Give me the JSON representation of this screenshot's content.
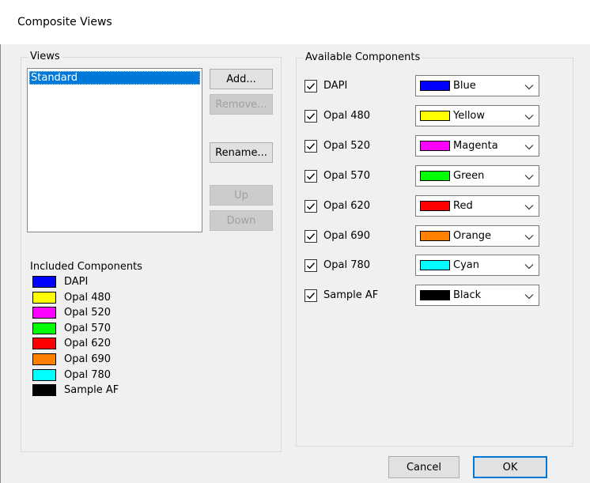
{
  "window": {
    "title": "Composite Views"
  },
  "views": {
    "label": "Views",
    "items": [
      "Standard"
    ],
    "buttons": {
      "add": "Add...",
      "remove": "Remove...",
      "rename": "Rename...",
      "up": "Up",
      "down": "Down"
    }
  },
  "included": {
    "label": "Included Components",
    "items": [
      {
        "name": "DAPI",
        "color": "#0000ff"
      },
      {
        "name": "Opal 480",
        "color": "#ffff00"
      },
      {
        "name": "Opal 520",
        "color": "#ff00ff"
      },
      {
        "name": "Opal 570",
        "color": "#00ff00"
      },
      {
        "name": "Opal 620",
        "color": "#ff0000"
      },
      {
        "name": "Opal 690",
        "color": "#ff7f00"
      },
      {
        "name": "Opal 780",
        "color": "#00ffff"
      },
      {
        "name": "Sample AF",
        "color": "#000000"
      }
    ]
  },
  "available": {
    "label": "Available Components",
    "items": [
      {
        "name": "DAPI",
        "checked": true,
        "color_name": "Blue",
        "color": "#0000ff"
      },
      {
        "name": "Opal 480",
        "checked": true,
        "color_name": "Yellow",
        "color": "#ffff00"
      },
      {
        "name": "Opal 520",
        "checked": true,
        "color_name": "Magenta",
        "color": "#ff00ff"
      },
      {
        "name": "Opal 570",
        "checked": true,
        "color_name": "Green",
        "color": "#00ff00"
      },
      {
        "name": "Opal 620",
        "checked": true,
        "color_name": "Red",
        "color": "#ff0000"
      },
      {
        "name": "Opal 690",
        "checked": true,
        "color_name": "Orange",
        "color": "#ff7f00"
      },
      {
        "name": "Opal 780",
        "checked": true,
        "color_name": "Cyan",
        "color": "#00ffff"
      },
      {
        "name": "Sample AF",
        "checked": true,
        "color_name": "Black",
        "color": "#000000"
      }
    ]
  },
  "footer": {
    "cancel": "Cancel",
    "ok": "OK"
  }
}
